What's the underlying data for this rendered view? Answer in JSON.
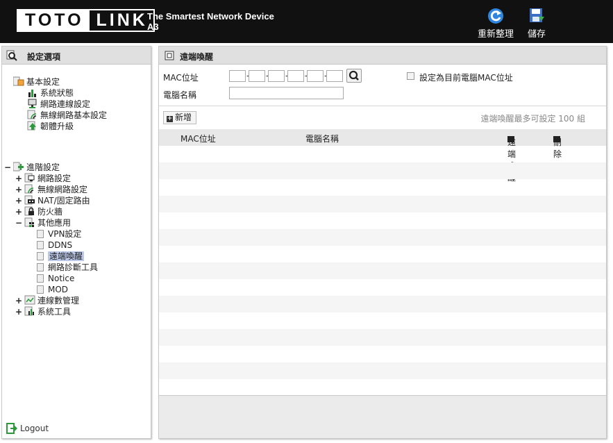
{
  "header": {
    "logo_part1": "TOTO",
    "logo_part2": "LINK",
    "tagline_line1": "The Smartest Network Device",
    "tagline_line2": "A3",
    "reboot_label": "重新整理",
    "save_label": "儲存",
    "bg_color": "#111111"
  },
  "sidebar": {
    "title": "設定選項",
    "basic": {
      "label": "基本設定",
      "items": [
        {
          "label": "系統狀態",
          "icon": "bar-chart-icon"
        },
        {
          "label": "網路連線設定",
          "icon": "monitor-icon"
        },
        {
          "label": "無線網路基本設定",
          "icon": "wifi-icon"
        },
        {
          "label": "韌體升級",
          "icon": "upgrade-icon"
        }
      ]
    },
    "advanced": {
      "label": "進階設定",
      "toggle": "−",
      "groups": [
        {
          "label": "網路設定",
          "toggle": "+",
          "icon": "network-icon"
        },
        {
          "label": "無線網路設定",
          "toggle": "+",
          "icon": "wifi-icon"
        },
        {
          "label": "NAT/固定路由",
          "toggle": "+",
          "icon": "router-icon"
        },
        {
          "label": "防火牆",
          "toggle": "+",
          "icon": "lock-icon"
        },
        {
          "label": "其他應用",
          "toggle": "−",
          "icon": "apps-icon"
        }
      ],
      "other_apps": [
        "VPN設定",
        "DDNS",
        "遠端喚醒",
        "網路診斷工具",
        "Notice",
        "MOD"
      ],
      "selected": "遠端喚醒",
      "groups_after": [
        {
          "label": "連線數管理",
          "toggle": "+",
          "icon": "graph-icon"
        },
        {
          "label": "系統工具",
          "toggle": "+",
          "icon": "bar-chart-icon"
        }
      ]
    },
    "logout_label": "Logout",
    "selected_color": "#bcc9e8"
  },
  "main": {
    "title": "遠端喚醒",
    "mac_label": "MAC位址",
    "name_label": "電腦名稱",
    "mac_separator": "-",
    "use_current_mac_label": "設定為目前電腦MAC位址",
    "add_label": "新增",
    "max_note": "遠端喚醒最多可設定 100 組",
    "table": {
      "col_mac": "MAC位址",
      "col_name": "電腦名稱",
      "wake_label": "遠端喚醒",
      "delete_label": "刪除"
    }
  }
}
